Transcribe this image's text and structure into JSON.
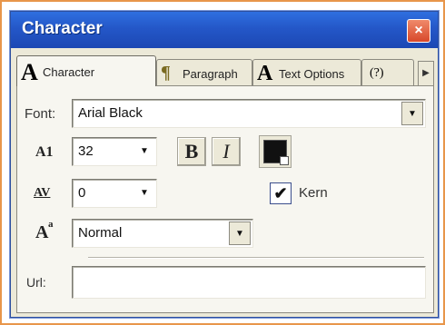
{
  "window": {
    "title": "Character",
    "close_glyph": "×"
  },
  "tabs": [
    {
      "glyph": "A",
      "label": "Character",
      "icon": "character-icon"
    },
    {
      "glyph": "¶",
      "label": "Paragraph",
      "icon": "paragraph-icon"
    },
    {
      "glyph": "A",
      "label": "Text Options",
      "icon": "text-options-icon"
    },
    {
      "glyph": "(?)",
      "label": "",
      "icon": "help-icon"
    }
  ],
  "tab_scroll_glyph": "▶",
  "font": {
    "label": "Font:",
    "value": "Arial Black",
    "arrow": "▼"
  },
  "size": {
    "icon_text": "A1",
    "value": "32",
    "arrow": "▼"
  },
  "style_buttons": {
    "bold": "B",
    "italic": "I"
  },
  "color": {
    "swatch": "#111111"
  },
  "kerning_amount": {
    "icon_text": "AV",
    "value": "0",
    "arrow": "▼"
  },
  "kern": {
    "label": "Kern",
    "checked": true,
    "check_glyph": "✔"
  },
  "baseline": {
    "icon_text": "A",
    "value": "Normal",
    "arrow": "▼"
  },
  "url": {
    "label": "Url:",
    "value": ""
  },
  "colors": {
    "titlebar": "#2457c8",
    "frame": "#e8964a",
    "panel": "#f7f6f0"
  }
}
